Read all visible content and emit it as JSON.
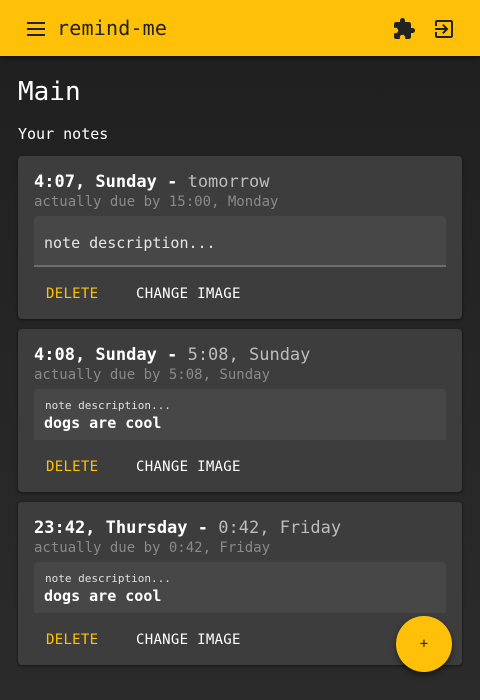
{
  "app": {
    "title": "remind-me",
    "menu_icon": "menu-icon",
    "extension_icon": "puzzle-icon",
    "logout_icon": "logout-icon",
    "accent_color": "#ffc107"
  },
  "page": {
    "title": "Main",
    "section_label": "Your notes"
  },
  "notes": [
    {
      "time": "4:07, Sunday",
      "separator": "-",
      "relative": "tomorrow",
      "due": "actually due by 15:00, Monday",
      "description_placeholder": "note description...",
      "description_value": "",
      "delete_label": "DELETE",
      "change_image_label": "CHANGE IMAGE"
    },
    {
      "time": "4:08, Sunday",
      "separator": "-",
      "relative": "5:08, Sunday",
      "due": "actually due by 5:08, Sunday",
      "description_placeholder": "note description...",
      "description_value": "dogs are cool",
      "delete_label": "DELETE",
      "change_image_label": "CHANGE IMAGE"
    },
    {
      "time": "23:42, Thursday",
      "separator": "-",
      "relative": "0:42, Friday",
      "due": "actually due by 0:42, Friday",
      "description_placeholder": "note description...",
      "description_value": "dogs are cool",
      "delete_label": "DELETE",
      "change_image_label": "CHANGE IMAGE"
    }
  ],
  "fab": {
    "label": "+"
  }
}
